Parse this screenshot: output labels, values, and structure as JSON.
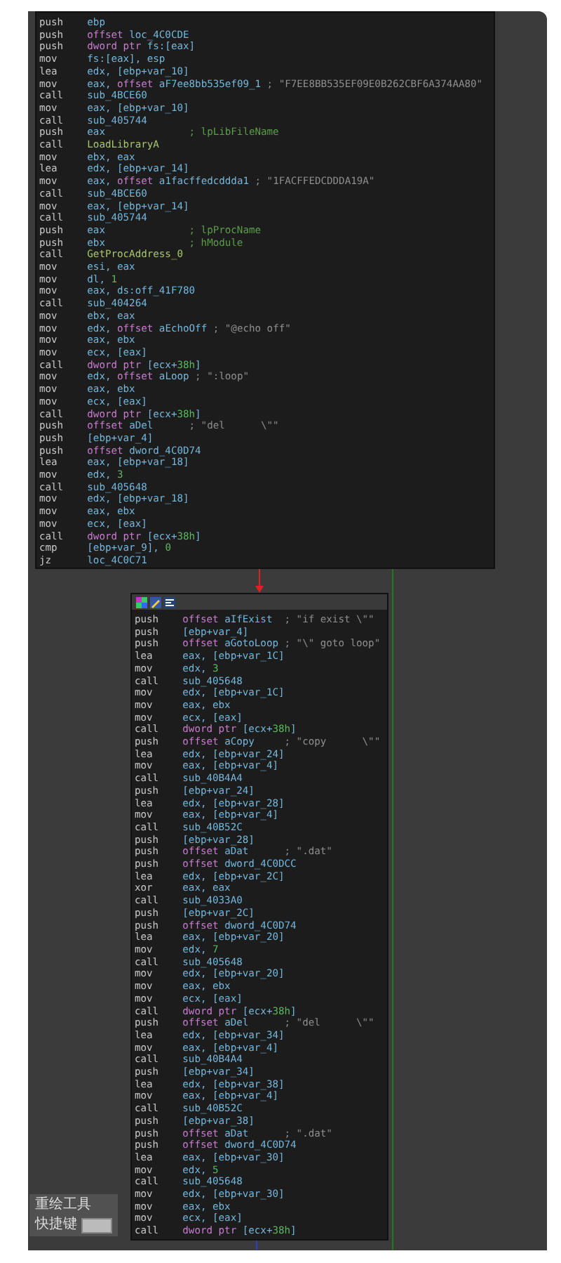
{
  "graph": {
    "blocks": [
      {
        "toolbar": false,
        "lines": [
          {
            "mnemonic": "push",
            "operands": [
              {
                "kind": "reg",
                "text": "ebp"
              }
            ]
          },
          {
            "mnemonic": "push",
            "operands": [
              {
                "kind": "kw",
                "text": "offset "
              },
              {
                "kind": "reg",
                "text": "loc_4C0CDE"
              }
            ]
          },
          {
            "mnemonic": "push",
            "operands": [
              {
                "kind": "kw",
                "text": "dword ptr "
              },
              {
                "kind": "reg",
                "text": "fs:[eax]"
              }
            ]
          },
          {
            "mnemonic": "mov",
            "operands": [
              {
                "kind": "reg",
                "text": "fs:[eax], esp"
              }
            ]
          },
          {
            "mnemonic": "lea",
            "operands": [
              {
                "kind": "reg",
                "text": "edx, [ebp+var_10]"
              }
            ]
          },
          {
            "mnemonic": "mov",
            "operands": [
              {
                "kind": "reg",
                "text": "eax, "
              },
              {
                "kind": "kw",
                "text": "offset "
              },
              {
                "kind": "reg",
                "text": "aF7ee8bb535ef09_1"
              }
            ],
            "comment": {
              "kind": "string",
              "text": "; \"F7EE8BB535EF09E0B262CBF6A374AA80\""
            }
          },
          {
            "mnemonic": "call",
            "operands": [
              {
                "kind": "reg",
                "text": "sub_4BCE60"
              }
            ]
          },
          {
            "mnemonic": "mov",
            "operands": [
              {
                "kind": "reg",
                "text": "eax, [ebp+var_10]"
              }
            ]
          },
          {
            "mnemonic": "call",
            "operands": [
              {
                "kind": "reg",
                "text": "sub_405744"
              }
            ]
          },
          {
            "mnemonic": "push",
            "operands": [
              {
                "kind": "reg",
                "text": "eax"
              }
            ],
            "comment": {
              "kind": "name",
              "text": "; lpLibFileName"
            }
          },
          {
            "mnemonic": "call",
            "operands": [
              {
                "kind": "api",
                "text": "LoadLibraryA"
              }
            ]
          },
          {
            "mnemonic": "mov",
            "operands": [
              {
                "kind": "reg",
                "text": "ebx, eax"
              }
            ]
          },
          {
            "mnemonic": "lea",
            "operands": [
              {
                "kind": "reg",
                "text": "edx, [ebp+var_14]"
              }
            ]
          },
          {
            "mnemonic": "mov",
            "operands": [
              {
                "kind": "reg",
                "text": "eax, "
              },
              {
                "kind": "kw",
                "text": "offset "
              },
              {
                "kind": "reg",
                "text": "a1facffedcddda1"
              }
            ],
            "comment": {
              "kind": "string",
              "text": "; \"1FACFFEDCDDDA19A\""
            }
          },
          {
            "mnemonic": "call",
            "operands": [
              {
                "kind": "reg",
                "text": "sub_4BCE60"
              }
            ]
          },
          {
            "mnemonic": "mov",
            "operands": [
              {
                "kind": "reg",
                "text": "eax, [ebp+var_14]"
              }
            ]
          },
          {
            "mnemonic": "call",
            "operands": [
              {
                "kind": "reg",
                "text": "sub_405744"
              }
            ]
          },
          {
            "mnemonic": "push",
            "operands": [
              {
                "kind": "reg",
                "text": "eax"
              }
            ],
            "comment": {
              "kind": "name",
              "text": "; lpProcName"
            }
          },
          {
            "mnemonic": "push",
            "operands": [
              {
                "kind": "reg",
                "text": "ebx"
              }
            ],
            "comment": {
              "kind": "name",
              "text": "; hModule"
            }
          },
          {
            "mnemonic": "call",
            "operands": [
              {
                "kind": "api",
                "text": "GetProcAddress_0"
              }
            ]
          },
          {
            "mnemonic": "mov",
            "operands": [
              {
                "kind": "reg",
                "text": "esi, eax"
              }
            ]
          },
          {
            "mnemonic": "mov",
            "operands": [
              {
                "kind": "reg",
                "text": "dl, "
              },
              {
                "kind": "num",
                "text": "1"
              }
            ]
          },
          {
            "mnemonic": "mov",
            "operands": [
              {
                "kind": "reg",
                "text": "eax, ds:off_41F780"
              }
            ]
          },
          {
            "mnemonic": "call",
            "operands": [
              {
                "kind": "reg",
                "text": "sub_404264"
              }
            ]
          },
          {
            "mnemonic": "mov",
            "operands": [
              {
                "kind": "reg",
                "text": "ebx, eax"
              }
            ]
          },
          {
            "mnemonic": "mov",
            "operands": [
              {
                "kind": "reg",
                "text": "edx, "
              },
              {
                "kind": "kw",
                "text": "offset "
              },
              {
                "kind": "reg",
                "text": "aEchoOff"
              }
            ],
            "comment": {
              "kind": "string",
              "text": "; \"@echo off\""
            }
          },
          {
            "mnemonic": "mov",
            "operands": [
              {
                "kind": "reg",
                "text": "eax, ebx"
              }
            ]
          },
          {
            "mnemonic": "mov",
            "operands": [
              {
                "kind": "reg",
                "text": "ecx, [eax]"
              }
            ]
          },
          {
            "mnemonic": "call",
            "operands": [
              {
                "kind": "kw",
                "text": "dword ptr "
              },
              {
                "kind": "reg",
                "text": "[ecx+"
              },
              {
                "kind": "num",
                "text": "38h"
              },
              {
                "kind": "reg",
                "text": "]"
              }
            ]
          },
          {
            "mnemonic": "mov",
            "operands": [
              {
                "kind": "reg",
                "text": "edx, "
              },
              {
                "kind": "kw",
                "text": "offset "
              },
              {
                "kind": "reg",
                "text": "aLoop"
              }
            ],
            "comment": {
              "kind": "string",
              "text": "; \":loop\""
            }
          },
          {
            "mnemonic": "mov",
            "operands": [
              {
                "kind": "reg",
                "text": "eax, ebx"
              }
            ]
          },
          {
            "mnemonic": "mov",
            "operands": [
              {
                "kind": "reg",
                "text": "ecx, [eax]"
              }
            ]
          },
          {
            "mnemonic": "call",
            "operands": [
              {
                "kind": "kw",
                "text": "dword ptr "
              },
              {
                "kind": "reg",
                "text": "[ecx+"
              },
              {
                "kind": "num",
                "text": "38h"
              },
              {
                "kind": "reg",
                "text": "]"
              }
            ]
          },
          {
            "mnemonic": "push",
            "operands": [
              {
                "kind": "kw",
                "text": "offset "
              },
              {
                "kind": "reg",
                "text": "aDel"
              }
            ],
            "comment": {
              "kind": "string",
              "text": "; \"del      \\\"\""
            }
          },
          {
            "mnemonic": "push",
            "operands": [
              {
                "kind": "reg",
                "text": "[ebp+var_4]"
              }
            ]
          },
          {
            "mnemonic": "push",
            "operands": [
              {
                "kind": "kw",
                "text": "offset "
              },
              {
                "kind": "reg",
                "text": "dword_4C0D74"
              }
            ]
          },
          {
            "mnemonic": "lea",
            "operands": [
              {
                "kind": "reg",
                "text": "eax, [ebp+var_18]"
              }
            ]
          },
          {
            "mnemonic": "mov",
            "operands": [
              {
                "kind": "reg",
                "text": "edx, "
              },
              {
                "kind": "num",
                "text": "3"
              }
            ]
          },
          {
            "mnemonic": "call",
            "operands": [
              {
                "kind": "reg",
                "text": "sub_405648"
              }
            ]
          },
          {
            "mnemonic": "mov",
            "operands": [
              {
                "kind": "reg",
                "text": "edx, [ebp+var_18]"
              }
            ]
          },
          {
            "mnemonic": "mov",
            "operands": [
              {
                "kind": "reg",
                "text": "eax, ebx"
              }
            ]
          },
          {
            "mnemonic": "mov",
            "operands": [
              {
                "kind": "reg",
                "text": "ecx, [eax]"
              }
            ]
          },
          {
            "mnemonic": "call",
            "operands": [
              {
                "kind": "kw",
                "text": "dword ptr "
              },
              {
                "kind": "reg",
                "text": "[ecx+"
              },
              {
                "kind": "num",
                "text": "38h"
              },
              {
                "kind": "reg",
                "text": "]"
              }
            ]
          },
          {
            "mnemonic": "cmp",
            "operands": [
              {
                "kind": "reg",
                "text": "[ebp+var_9], "
              },
              {
                "kind": "num",
                "text": "0"
              }
            ]
          },
          {
            "mnemonic": "jz",
            "operands": [
              {
                "kind": "reg",
                "text": "loc_4C0C71"
              }
            ]
          }
        ]
      },
      {
        "toolbar": true,
        "lines": [
          {
            "mnemonic": "push",
            "operands": [
              {
                "kind": "kw",
                "text": "offset "
              },
              {
                "kind": "reg",
                "text": "aIfExist"
              }
            ],
            "comment": {
              "kind": "string",
              "text": "; \"if exist \\\"\""
            }
          },
          {
            "mnemonic": "push",
            "operands": [
              {
                "kind": "reg",
                "text": "[ebp+var_4]"
              }
            ]
          },
          {
            "mnemonic": "push",
            "operands": [
              {
                "kind": "kw",
                "text": "offset "
              },
              {
                "kind": "reg",
                "text": "aGotoLoop"
              }
            ],
            "comment": {
              "kind": "string",
              "text": "; \"\\\" goto loop\""
            }
          },
          {
            "mnemonic": "lea",
            "operands": [
              {
                "kind": "reg",
                "text": "eax, [ebp+var_1C]"
              }
            ]
          },
          {
            "mnemonic": "mov",
            "operands": [
              {
                "kind": "reg",
                "text": "edx, "
              },
              {
                "kind": "num",
                "text": "3"
              }
            ]
          },
          {
            "mnemonic": "call",
            "operands": [
              {
                "kind": "reg",
                "text": "sub_405648"
              }
            ]
          },
          {
            "mnemonic": "mov",
            "operands": [
              {
                "kind": "reg",
                "text": "edx, [ebp+var_1C]"
              }
            ]
          },
          {
            "mnemonic": "mov",
            "operands": [
              {
                "kind": "reg",
                "text": "eax, ebx"
              }
            ]
          },
          {
            "mnemonic": "mov",
            "operands": [
              {
                "kind": "reg",
                "text": "ecx, [eax]"
              }
            ]
          },
          {
            "mnemonic": "call",
            "operands": [
              {
                "kind": "kw",
                "text": "dword ptr "
              },
              {
                "kind": "reg",
                "text": "[ecx+"
              },
              {
                "kind": "num",
                "text": "38h"
              },
              {
                "kind": "reg",
                "text": "]"
              }
            ]
          },
          {
            "mnemonic": "push",
            "operands": [
              {
                "kind": "kw",
                "text": "offset "
              },
              {
                "kind": "reg",
                "text": "aCopy"
              }
            ],
            "comment": {
              "kind": "string",
              "text": "; \"copy      \\\"\""
            }
          },
          {
            "mnemonic": "lea",
            "operands": [
              {
                "kind": "reg",
                "text": "edx, [ebp+var_24]"
              }
            ]
          },
          {
            "mnemonic": "mov",
            "operands": [
              {
                "kind": "reg",
                "text": "eax, [ebp+var_4]"
              }
            ]
          },
          {
            "mnemonic": "call",
            "operands": [
              {
                "kind": "reg",
                "text": "sub_40B4A4"
              }
            ]
          },
          {
            "mnemonic": "push",
            "operands": [
              {
                "kind": "reg",
                "text": "[ebp+var_24]"
              }
            ]
          },
          {
            "mnemonic": "lea",
            "operands": [
              {
                "kind": "reg",
                "text": "edx, [ebp+var_28]"
              }
            ]
          },
          {
            "mnemonic": "mov",
            "operands": [
              {
                "kind": "reg",
                "text": "eax, [ebp+var_4]"
              }
            ]
          },
          {
            "mnemonic": "call",
            "operands": [
              {
                "kind": "reg",
                "text": "sub_40B52C"
              }
            ]
          },
          {
            "mnemonic": "push",
            "operands": [
              {
                "kind": "reg",
                "text": "[ebp+var_28]"
              }
            ]
          },
          {
            "mnemonic": "push",
            "operands": [
              {
                "kind": "kw",
                "text": "offset "
              },
              {
                "kind": "reg",
                "text": "aDat"
              }
            ],
            "comment": {
              "kind": "string",
              "text": "; \".dat\""
            }
          },
          {
            "mnemonic": "push",
            "operands": [
              {
                "kind": "kw",
                "text": "offset "
              },
              {
                "kind": "reg",
                "text": "dword_4C0DCC"
              }
            ]
          },
          {
            "mnemonic": "lea",
            "operands": [
              {
                "kind": "reg",
                "text": "edx, [ebp+var_2C]"
              }
            ]
          },
          {
            "mnemonic": "xor",
            "operands": [
              {
                "kind": "reg",
                "text": "eax, eax"
              }
            ]
          },
          {
            "mnemonic": "call",
            "operands": [
              {
                "kind": "reg",
                "text": "sub_4033A0"
              }
            ]
          },
          {
            "mnemonic": "push",
            "operands": [
              {
                "kind": "reg",
                "text": "[ebp+var_2C]"
              }
            ]
          },
          {
            "mnemonic": "push",
            "operands": [
              {
                "kind": "kw",
                "text": "offset "
              },
              {
                "kind": "reg",
                "text": "dword_4C0D74"
              }
            ]
          },
          {
            "mnemonic": "lea",
            "operands": [
              {
                "kind": "reg",
                "text": "eax, [ebp+var_20]"
              }
            ]
          },
          {
            "mnemonic": "mov",
            "operands": [
              {
                "kind": "reg",
                "text": "edx, "
              },
              {
                "kind": "num",
                "text": "7"
              }
            ]
          },
          {
            "mnemonic": "call",
            "operands": [
              {
                "kind": "reg",
                "text": "sub_405648"
              }
            ]
          },
          {
            "mnemonic": "mov",
            "operands": [
              {
                "kind": "reg",
                "text": "edx, [ebp+var_20]"
              }
            ]
          },
          {
            "mnemonic": "mov",
            "operands": [
              {
                "kind": "reg",
                "text": "eax, ebx"
              }
            ]
          },
          {
            "mnemonic": "mov",
            "operands": [
              {
                "kind": "reg",
                "text": "ecx, [eax]"
              }
            ]
          },
          {
            "mnemonic": "call",
            "operands": [
              {
                "kind": "kw",
                "text": "dword ptr "
              },
              {
                "kind": "reg",
                "text": "[ecx+"
              },
              {
                "kind": "num",
                "text": "38h"
              },
              {
                "kind": "reg",
                "text": "]"
              }
            ]
          },
          {
            "mnemonic": "push",
            "operands": [
              {
                "kind": "kw",
                "text": "offset "
              },
              {
                "kind": "reg",
                "text": "aDel"
              }
            ],
            "comment": {
              "kind": "string",
              "text": "; \"del      \\\"\""
            }
          },
          {
            "mnemonic": "lea",
            "operands": [
              {
                "kind": "reg",
                "text": "edx, [ebp+var_34]"
              }
            ]
          },
          {
            "mnemonic": "mov",
            "operands": [
              {
                "kind": "reg",
                "text": "eax, [ebp+var_4]"
              }
            ]
          },
          {
            "mnemonic": "call",
            "operands": [
              {
                "kind": "reg",
                "text": "sub_40B4A4"
              }
            ]
          },
          {
            "mnemonic": "push",
            "operands": [
              {
                "kind": "reg",
                "text": "[ebp+var_34]"
              }
            ]
          },
          {
            "mnemonic": "lea",
            "operands": [
              {
                "kind": "reg",
                "text": "edx, [ebp+var_38]"
              }
            ]
          },
          {
            "mnemonic": "mov",
            "operands": [
              {
                "kind": "reg",
                "text": "eax, [ebp+var_4]"
              }
            ]
          },
          {
            "mnemonic": "call",
            "operands": [
              {
                "kind": "reg",
                "text": "sub_40B52C"
              }
            ]
          },
          {
            "mnemonic": "push",
            "operands": [
              {
                "kind": "reg",
                "text": "[ebp+var_38]"
              }
            ]
          },
          {
            "mnemonic": "push",
            "operands": [
              {
                "kind": "kw",
                "text": "offset "
              },
              {
                "kind": "reg",
                "text": "aDat"
              }
            ],
            "comment": {
              "kind": "string",
              "text": "; \".dat\""
            }
          },
          {
            "mnemonic": "push",
            "operands": [
              {
                "kind": "kw",
                "text": "offset "
              },
              {
                "kind": "reg",
                "text": "dword_4C0D74"
              }
            ]
          },
          {
            "mnemonic": "lea",
            "operands": [
              {
                "kind": "reg",
                "text": "eax, [ebp+var_30]"
              }
            ]
          },
          {
            "mnemonic": "mov",
            "operands": [
              {
                "kind": "reg",
                "text": "edx, "
              },
              {
                "kind": "num",
                "text": "5"
              }
            ]
          },
          {
            "mnemonic": "call",
            "operands": [
              {
                "kind": "reg",
                "text": "sub_405648"
              }
            ]
          },
          {
            "mnemonic": "mov",
            "operands": [
              {
                "kind": "reg",
                "text": "edx, [ebp+var_30]"
              }
            ]
          },
          {
            "mnemonic": "mov",
            "operands": [
              {
                "kind": "reg",
                "text": "eax, ebx"
              }
            ]
          },
          {
            "mnemonic": "mov",
            "operands": [
              {
                "kind": "reg",
                "text": "ecx, [eax]"
              }
            ]
          },
          {
            "mnemonic": "call",
            "operands": [
              {
                "kind": "kw",
                "text": "dword ptr "
              },
              {
                "kind": "reg",
                "text": "[ecx+"
              },
              {
                "kind": "num",
                "text": "38h"
              },
              {
                "kind": "reg",
                "text": "]"
              }
            ]
          }
        ]
      }
    ],
    "overlay": {
      "title": "重绘工具",
      "shortcut_label": "快捷键"
    }
  }
}
